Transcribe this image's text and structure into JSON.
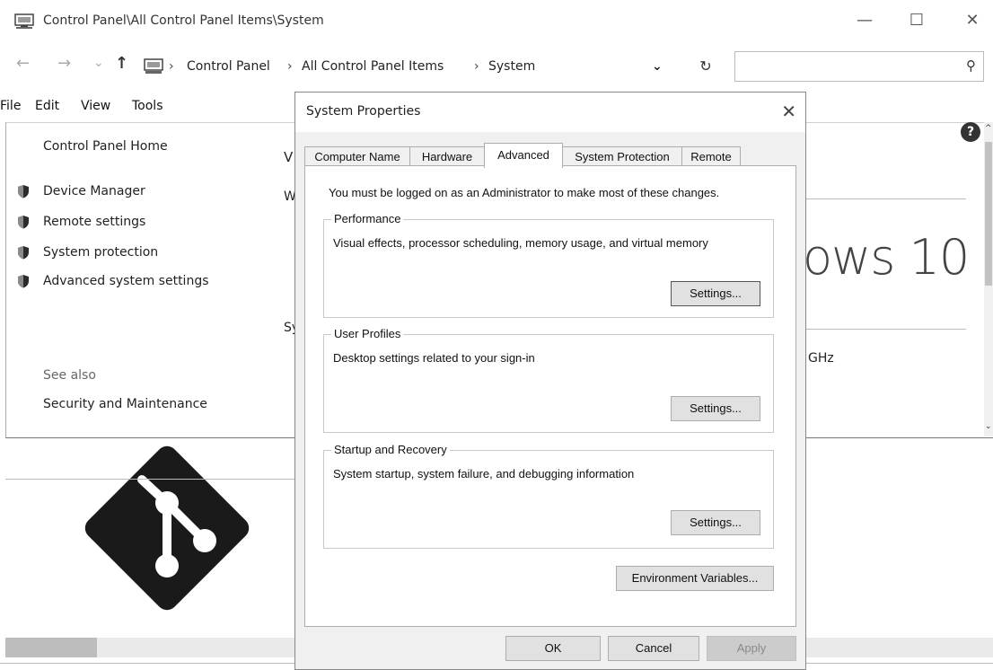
{
  "window": {
    "title": "Control Panel\\All Control Panel Items\\System",
    "controls": {
      "minimize": "—",
      "maximize": "☐",
      "close": "✕"
    }
  },
  "address": {
    "back": "←",
    "forward": "→",
    "recent": "⌄",
    "up": "↑",
    "breadcrumbs": [
      "Control Panel",
      "All Control Panel Items",
      "System"
    ],
    "separator": "›",
    "dropdown": "⌄",
    "refresh": "↻",
    "search_value": "",
    "search_glyph": "⚲"
  },
  "menu": {
    "items": [
      "File",
      "Edit",
      "View",
      "Tools"
    ]
  },
  "sidebar": {
    "home": "Control Panel Home",
    "links": [
      "Device Manager",
      "Remote settings",
      "System protection",
      "Advanced system settings"
    ],
    "see_also_heading": "See also",
    "see_also_links": [
      "Security and Maintenance"
    ]
  },
  "main": {
    "peek_1": "V",
    "peek_2": "W",
    "peek_3": "Sy",
    "windows_brand": "ows 10",
    "cpu_fragment": "GHz",
    "help_glyph": "?",
    "scroll_up": "^",
    "scroll_down": "⌄"
  },
  "dialog": {
    "title": "System Properties",
    "close": "✕",
    "tabs": [
      "Computer Name",
      "Hardware",
      "Advanced",
      "System Protection",
      "Remote"
    ],
    "active_tab": "Advanced",
    "note": "You must be logged on as an Administrator to make most of these changes.",
    "groups": [
      {
        "title": "Performance",
        "desc": "Visual effects, processor scheduling, memory usage, and virtual memory",
        "button": "Settings..."
      },
      {
        "title": "User Profiles",
        "desc": "Desktop settings related to your sign-in",
        "button": "Settings..."
      },
      {
        "title": "Startup and Recovery",
        "desc": "System startup, system failure, and debugging information",
        "button": "Settings..."
      }
    ],
    "env_button": "Environment Variables...",
    "ok": "OK",
    "cancel": "Cancel",
    "apply": "Apply"
  },
  "colors": {
    "logo": "#1a1a1a",
    "shield_dark": "#2b2b2b",
    "shield_light": "#8a8a8a"
  }
}
